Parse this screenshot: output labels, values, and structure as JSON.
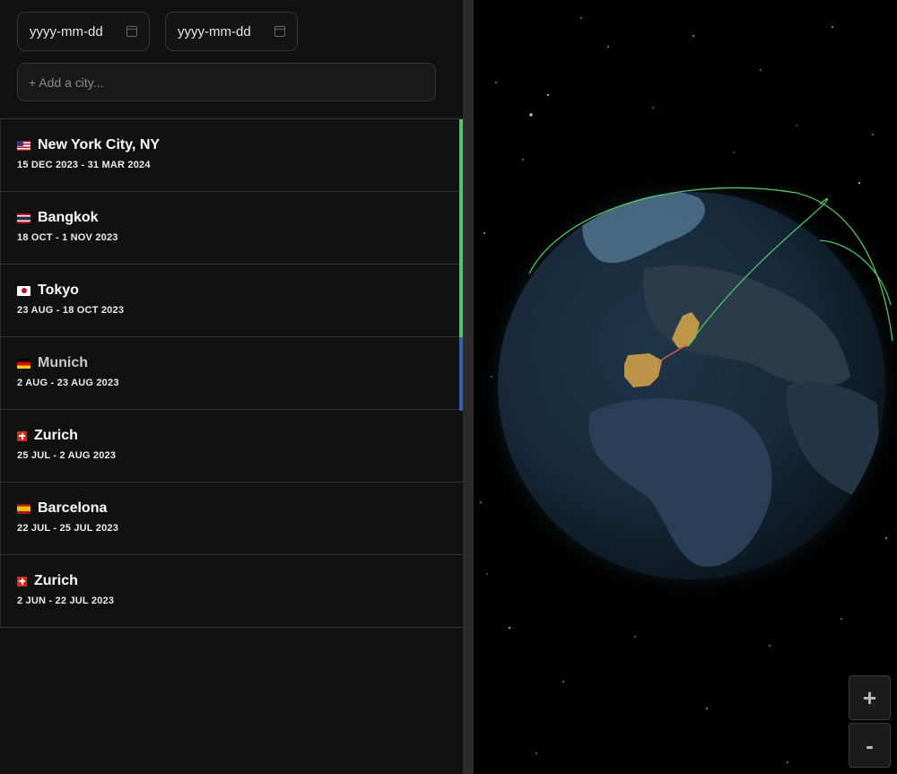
{
  "filters": {
    "start_date_placeholder": "yyyy-mm-dd",
    "end_date_placeholder": "yyyy-mm-dd",
    "city_placeholder": "+ Add a city..."
  },
  "trips": [
    {
      "city": "New York City, NY",
      "dates": "15 DEC 2023 - 31 MAR 2024",
      "flag": "us-flag-icon",
      "bar_color": "#4fc46b"
    },
    {
      "city": "Bangkok",
      "dates": "18 OCT - 1 NOV 2023",
      "flag": "thailand-flag-icon",
      "bar_color": "#4fc46b"
    },
    {
      "city": "Tokyo",
      "dates": "23 AUG - 18 OCT 2023",
      "flag": "japan-flag-icon",
      "bar_color": "#4fc46b"
    },
    {
      "city": "Munich",
      "dates": "2 AUG - 23 AUG 2023",
      "flag": "germany-flag-icon",
      "bar_color": "#3b5fa8"
    },
    {
      "city": "Zurich",
      "dates": "25 JUL - 2 AUG 2023",
      "flag": "switzerland-flag-icon",
      "bar_color": ""
    },
    {
      "city": "Barcelona",
      "dates": "22 JUL - 25 JUL 2023",
      "flag": "spain-flag-icon",
      "bar_color": ""
    },
    {
      "city": "Zurich",
      "dates": "2 JUN - 22 JUL 2023",
      "flag": "switzerland-flag-icon",
      "bar_color": ""
    }
  ],
  "globe": {
    "zoom_in_label": "+",
    "zoom_out_label": "-",
    "route_color": "#4fc46b",
    "highlight_color": "#d9a54a"
  }
}
